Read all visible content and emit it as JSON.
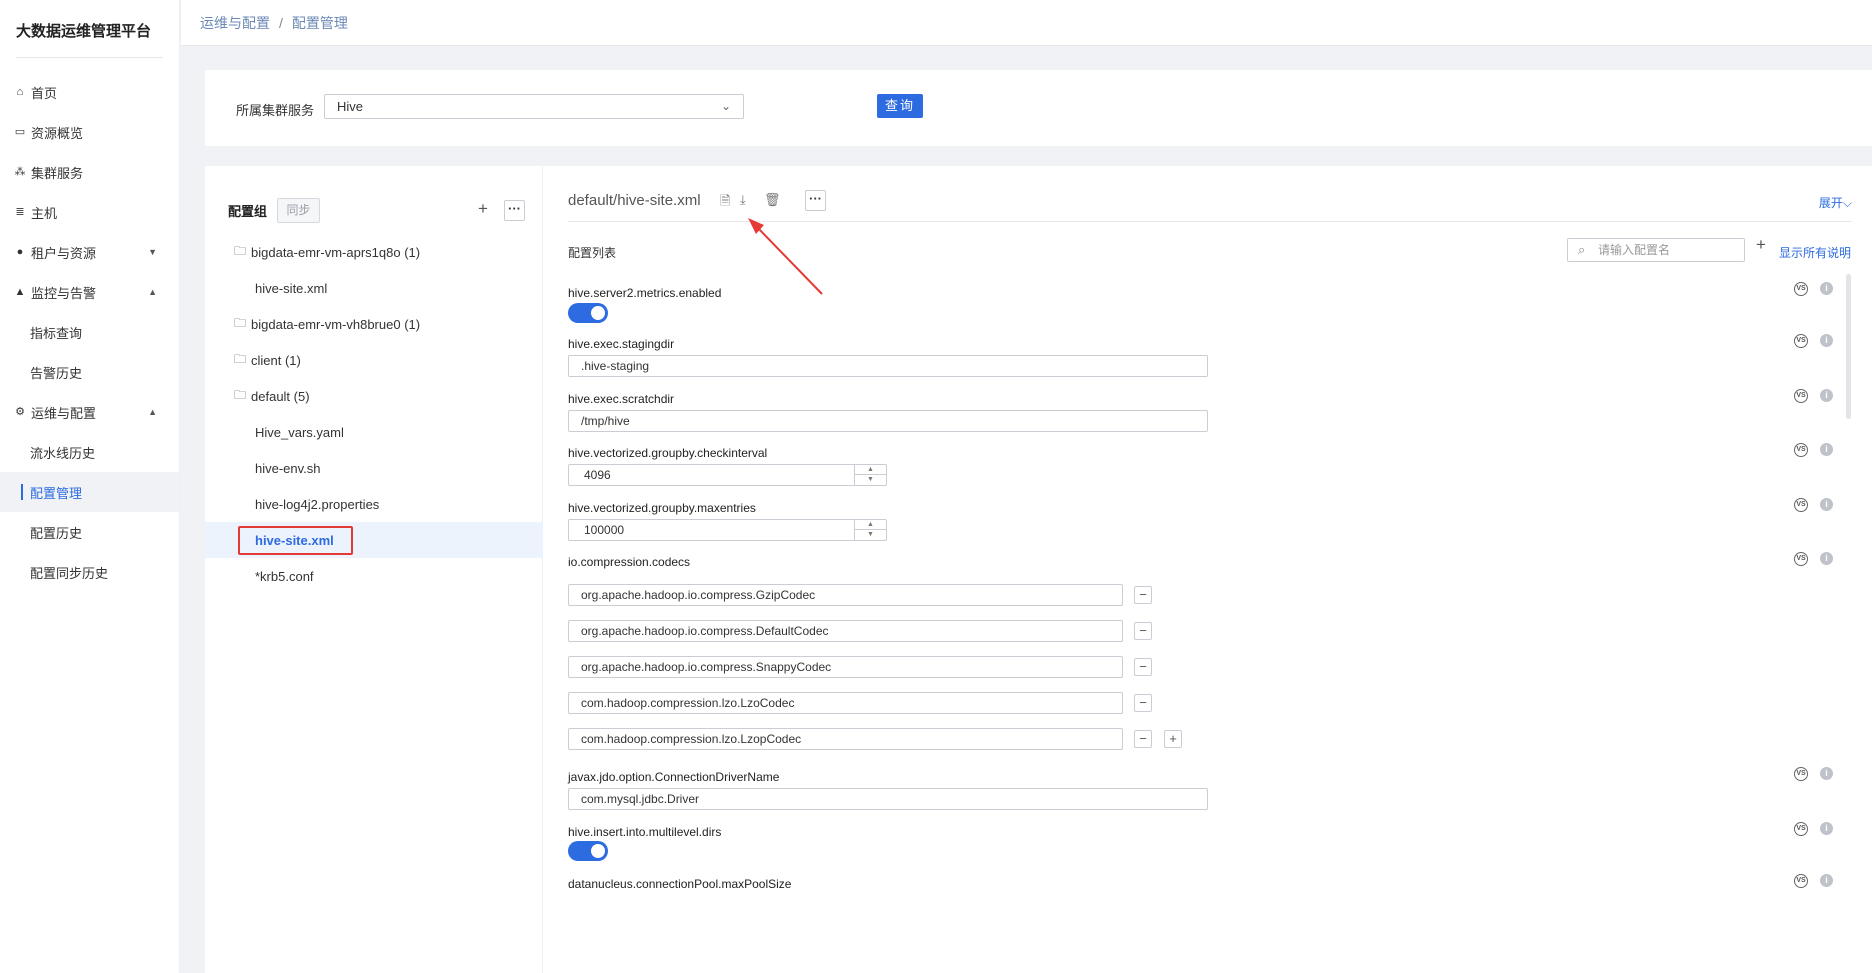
{
  "app": {
    "title": "大数据运维管理平台"
  },
  "sidebar": {
    "items": [
      {
        "label": "首页",
        "icon": "home-icon"
      },
      {
        "label": "资源概览",
        "icon": "monitor-icon"
      },
      {
        "label": "集群服务",
        "icon": "cluster-icon"
      },
      {
        "label": "主机",
        "icon": "server-icon"
      },
      {
        "label": "租户与资源",
        "icon": "user-icon"
      },
      {
        "label": "监控与告警",
        "icon": "bell-icon"
      },
      {
        "label": "指标查询"
      },
      {
        "label": "告警历史"
      },
      {
        "label": "运维与配置",
        "icon": "gear-icon"
      },
      {
        "label": "流水线历史"
      },
      {
        "label": "配置管理"
      },
      {
        "label": "配置历史"
      },
      {
        "label": "配置同步历史"
      }
    ]
  },
  "breadcrumb": {
    "parent": "运维与配置",
    "current": "配置管理"
  },
  "filter": {
    "label": "所属集群服务",
    "selected": "Hive",
    "query_label": "查询"
  },
  "tree": {
    "title": "配置组",
    "sync_label": "同步",
    "groups": [
      {
        "name": "bigdata-emr-vm-aprs1q8o (1)",
        "files": [
          "hive-site.xml"
        ]
      },
      {
        "name": "bigdata-emr-vm-vh8brue0 (1)",
        "files": []
      },
      {
        "name": "client (1)",
        "files": []
      },
      {
        "name": "default (5)",
        "files": [
          "Hive_vars.yaml",
          "hive-env.sh",
          "hive-log4j2.properties",
          "hive-site.xml",
          "*krb5.conf"
        ]
      }
    ],
    "selected": "hive-site.xml"
  },
  "config": {
    "file_path": "default/hive-site.xml",
    "expand_label": "展开",
    "list_title": "配置列表",
    "search_placeholder": "请输入配置名",
    "show_desc_label": "显示所有说明",
    "props": [
      {
        "name": "hive.server2.metrics.enabled",
        "type": "toggle",
        "value": true
      },
      {
        "name": "hive.exec.stagingdir",
        "type": "text",
        "value": ".hive-staging"
      },
      {
        "name": "hive.exec.scratchdir",
        "type": "text",
        "value": "/tmp/hive"
      },
      {
        "name": "hive.vectorized.groupby.checkinterval",
        "type": "number",
        "value": "4096"
      },
      {
        "name": "hive.vectorized.groupby.maxentries",
        "type": "number",
        "value": "100000"
      },
      {
        "name": "io.compression.codecs",
        "type": "list",
        "values": [
          "org.apache.hadoop.io.compress.GzipCodec",
          "org.apache.hadoop.io.compress.DefaultCodec",
          "org.apache.hadoop.io.compress.SnappyCodec",
          "com.hadoop.compression.lzo.LzoCodec",
          "com.hadoop.compression.lzo.LzopCodec"
        ]
      },
      {
        "name": "javax.jdo.option.ConnectionDriverName",
        "type": "text",
        "value": "com.mysql.jdbc.Driver"
      },
      {
        "name": "hive.insert.into.multilevel.dirs",
        "type": "toggle",
        "value": true
      },
      {
        "name": "datanucleus.connectionPool.maxPoolSize",
        "type": "number",
        "value": ""
      }
    ],
    "vs_glyph": "VS",
    "info_glyph": "i"
  },
  "colors": {
    "accent": "#2c6be0",
    "highlight": "#e53935"
  }
}
